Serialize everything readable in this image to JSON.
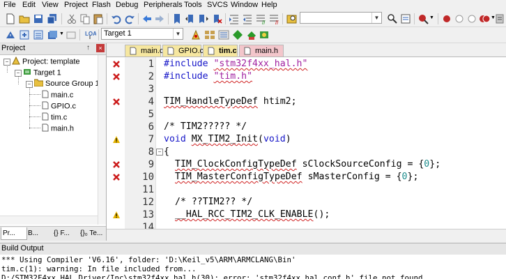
{
  "menu": [
    "File",
    "Edit",
    "View",
    "Project",
    "Flash",
    "Debug",
    "Peripherals",
    "Tools",
    "SVCS",
    "Window",
    "Help"
  ],
  "toolbar": {
    "target_label": "Target 1"
  },
  "project_panel": {
    "title": "Project",
    "pin": "↑",
    "close": "×",
    "tree": {
      "project": "Project: template",
      "target": "Target 1",
      "group": "Source Group 1",
      "files": [
        "main.c",
        "GPIO.c",
        "tim.c",
        "main.h"
      ]
    },
    "tabs": [
      "Pr...",
      "B...",
      "{} F...",
      "{}₀ Te..."
    ]
  },
  "editor": {
    "tabs": [
      {
        "label": "main.c",
        "active": false,
        "color": "#f6e7a0"
      },
      {
        "label": "GPIO.c",
        "active": false,
        "color": "#f6e7a0"
      },
      {
        "label": "tim.c",
        "active": true,
        "color": "#f6e7a0"
      },
      {
        "label": "main.h",
        "active": false,
        "color": "#f3c6cb"
      }
    ],
    "lines": [
      {
        "n": "1",
        "mark": "error"
      },
      {
        "n": "2",
        "mark": "error"
      },
      {
        "n": "3",
        "mark": ""
      },
      {
        "n": "4",
        "mark": "error"
      },
      {
        "n": "5",
        "mark": ""
      },
      {
        "n": "6",
        "mark": ""
      },
      {
        "n": "7",
        "mark": "warning"
      },
      {
        "n": "8",
        "mark": ""
      },
      {
        "n": "9",
        "mark": "error"
      },
      {
        "n": "10",
        "mark": "error"
      },
      {
        "n": "11",
        "mark": ""
      },
      {
        "n": "12",
        "mark": ""
      },
      {
        "n": "13",
        "mark": "warning"
      },
      {
        "n": "14",
        "mark": ""
      }
    ],
    "code": {
      "l1_kw": "#include ",
      "l1_str": "\"stm32f4xx_hal.h\"",
      "l2_kw": "#include ",
      "l2_str": "\"tim.h\"",
      "l4_type": "TIM_HandleTypeDef",
      "l4_rest": " htim2;",
      "l6": "/* TIM2????? */",
      "l7_void": "void ",
      "l7_fn": "MX_TIM2_Init",
      "l7_open": "(",
      "l7_arg": "void",
      "l7_close": ")",
      "l8": "{",
      "l9_type": "TIM_ClockConfigTypeDef",
      "l9_rest": " sClockSourceConfig = {",
      "l9_zero": "0",
      "l9_end": "};",
      "l10_type": "TIM_MasterConfigTypeDef",
      "l10_rest": " sMasterConfig = {",
      "l10_zero": "0",
      "l10_end": "};",
      "l12": "/* ??TIM2?? */",
      "l13_fn": "__HAL_RCC_TIM2_CLK_ENABLE",
      "l13_rest": "();"
    }
  },
  "build_output": {
    "title": "Build Output",
    "lines": [
      "*** Using Compiler 'V6.16', folder: 'D:\\Keil_v5\\ARM\\ARMCLANG\\Bin'",
      "tim.c(1): warning: In file included from...",
      "D:/STM32F4xx_HAL_Driver/Inc\\stm32f4xx_hal.h(30): error: 'stm32f4xx_hal_conf.h' file not found"
    ]
  },
  "colors": {
    "error": "#cc1b1b",
    "warning": "#e6b400",
    "keyword": "#1515c8",
    "string": "#a020a0",
    "comment": "#0a8a0a"
  }
}
